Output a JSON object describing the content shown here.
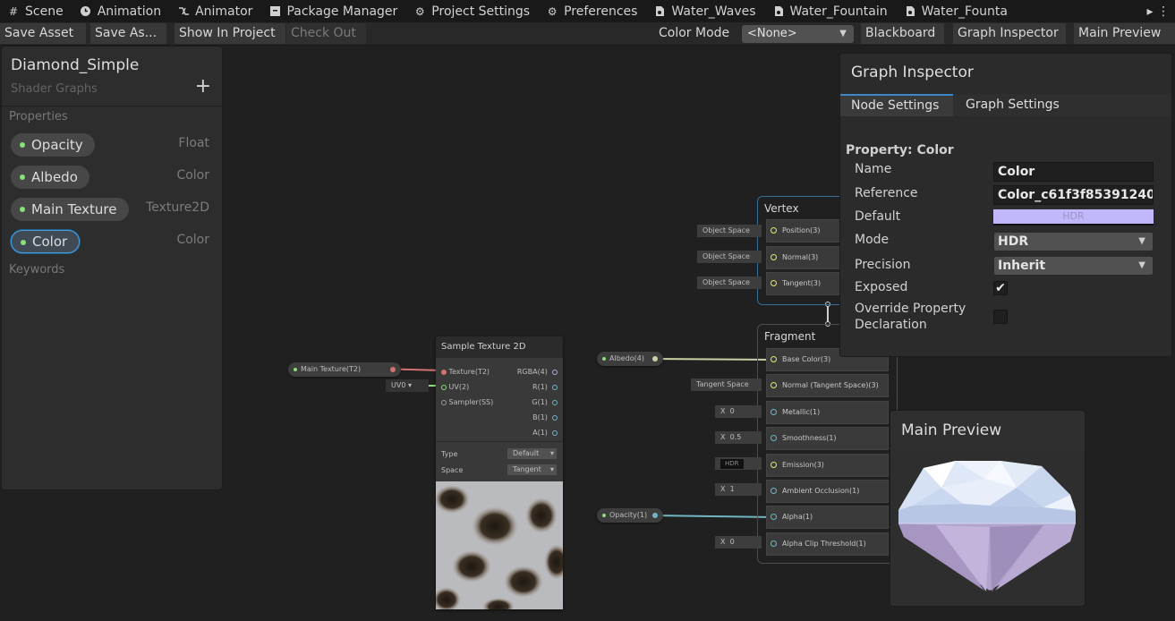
{
  "tabs": [
    {
      "label": "Scene",
      "icon": "grid-icon"
    },
    {
      "label": "Animation",
      "icon": "clock-icon"
    },
    {
      "label": "Animator",
      "icon": "animator-icon"
    },
    {
      "label": "Package Manager",
      "icon": "package-icon"
    },
    {
      "label": "Project Settings",
      "icon": "gear-icon"
    },
    {
      "label": "Preferences",
      "icon": "gear-icon"
    },
    {
      "label": "Water_Waves",
      "icon": "shader-graph-icon"
    },
    {
      "label": "Water_Fountain",
      "icon": "shader-graph-icon"
    },
    {
      "label": "Water_Founta",
      "icon": "shader-graph-icon"
    }
  ],
  "toolbar": {
    "save_asset": "Save Asset",
    "save_as": "Save As...",
    "show_in_project": "Show In Project",
    "check_out": "Check Out",
    "color_mode_label": "Color Mode",
    "color_mode_value": "<None>",
    "blackboard": "Blackboard",
    "graph_inspector": "Graph Inspector",
    "main_preview": "Main Preview"
  },
  "blackboard": {
    "title": "Diamond_Simple",
    "subtitle": "Shader Graphs",
    "properties_header": "Properties",
    "keywords_header": "Keywords",
    "properties": [
      {
        "name": "Opacity",
        "type": "Float",
        "selected": false
      },
      {
        "name": "Albedo",
        "type": "Color",
        "selected": false
      },
      {
        "name": "Main Texture",
        "type": "Texture2D",
        "selected": false
      },
      {
        "name": "Color",
        "type": "Color",
        "selected": true
      }
    ]
  },
  "graph": {
    "main_texture_chip": "Main Texture(T2)",
    "uv_channel": "UV0",
    "sample_node": {
      "title": "Sample Texture 2D",
      "inputs": [
        "Texture(T2)",
        "UV(2)",
        "Sampler(SS)"
      ],
      "outputs": [
        "RGBA(4)",
        "R(1)",
        "G(1)",
        "B(1)",
        "A(1)"
      ],
      "type_label": "Type",
      "type_value": "Default",
      "space_label": "Space",
      "space_value": "Tangent"
    },
    "vertex": {
      "title": "Vertex",
      "blocks": [
        {
          "slot": "Object Space",
          "label": "Position(3)"
        },
        {
          "slot": "Object Space",
          "label": "Normal(3)"
        },
        {
          "slot": "Object Space",
          "label": "Tangent(3)"
        }
      ]
    },
    "fragment": {
      "title": "Fragment",
      "albedo_chip": "Albedo(4)",
      "opacity_chip": "Opacity(1)",
      "blocks": [
        {
          "slot": "",
          "label": "Base Color(3)"
        },
        {
          "slot": "Tangent Space",
          "label": "Normal (Tangent Space)(3)"
        },
        {
          "slot_x": "X",
          "slot": "0",
          "label": "Metallic(1)"
        },
        {
          "slot_x": "X",
          "slot": "0.5",
          "label": "Smoothness(1)"
        },
        {
          "slot": "HDR",
          "label": "Emission(3)"
        },
        {
          "slot_x": "X",
          "slot": "1",
          "label": "Ambient Occlusion(1)"
        },
        {
          "slot": "",
          "label": "Alpha(1)"
        },
        {
          "slot_x": "X",
          "slot": "0",
          "label": "Alpha Clip Threshold(1)"
        }
      ]
    }
  },
  "inspector": {
    "title": "Graph Inspector",
    "tab_node": "Node Settings",
    "tab_graph": "Graph Settings",
    "property_header": "Property: Color",
    "name_label": "Name",
    "name_value": "Color",
    "reference_label": "Reference",
    "reference_value": "Color_c61f3f85391240",
    "default_label": "Default",
    "default_text": "HDR",
    "default_color": "#c0b8fb",
    "mode_label": "Mode",
    "mode_value": "HDR",
    "precision_label": "Precision",
    "precision_value": "Inherit",
    "exposed_label": "Exposed",
    "exposed": true,
    "override_label_1": "Override Property",
    "override_label_2": "Declaration",
    "override": false
  },
  "preview": {
    "title": "Main Preview"
  },
  "colors": {
    "accent": "#3d87c8",
    "property_dot": "#8adf7a",
    "edge_texture": "#d37272",
    "edge_color": "#cbcfa4",
    "edge_float": "#6fb7c4"
  }
}
